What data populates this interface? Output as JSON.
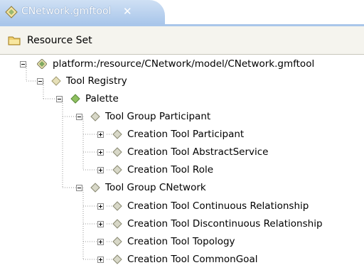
{
  "editor_tab": {
    "title": "CNetwork.gmftool",
    "close_glyph": "✕",
    "icon": "gmftool-file-icon"
  },
  "toolbar": {
    "icon": "folder-resource-set-icon",
    "label": "Resource Set"
  },
  "tree": {
    "root": {
      "label": "platform:/resource/CNetwork/model/CNetwork.gmftool",
      "expanded": true,
      "icon": "gmftool-resource-icon"
    },
    "registry": {
      "label": "Tool Registry",
      "expanded": true,
      "icon": "diamond-node-icon"
    },
    "palette": {
      "label": "Palette",
      "expanded": true,
      "icon": "diamond-node-icon"
    },
    "groups": [
      {
        "label": "Tool Group Participant",
        "expanded": true,
        "items": [
          {
            "label": "Creation Tool Participant",
            "expanded": false
          },
          {
            "label": "Creation Tool AbstractService",
            "expanded": false
          },
          {
            "label": "Creation Tool Role",
            "expanded": false
          }
        ]
      },
      {
        "label": "Tool Group CNetwork",
        "expanded": true,
        "items": [
          {
            "label": "Creation Tool Continuous Relationship",
            "expanded": false
          },
          {
            "label": "Creation Tool Discontinuous Relationship",
            "expanded": false
          },
          {
            "label": "Creation Tool Topology",
            "expanded": false
          },
          {
            "label": "Creation Tool CommonGoal",
            "expanded": false
          }
        ]
      }
    ]
  },
  "colors": {
    "tab_gradient_top": "#cfe0f4",
    "tab_gradient_bottom": "#a9c6ea",
    "diamond_icon": "#8fc060",
    "toolbar_bg": "#f5f4ee"
  }
}
